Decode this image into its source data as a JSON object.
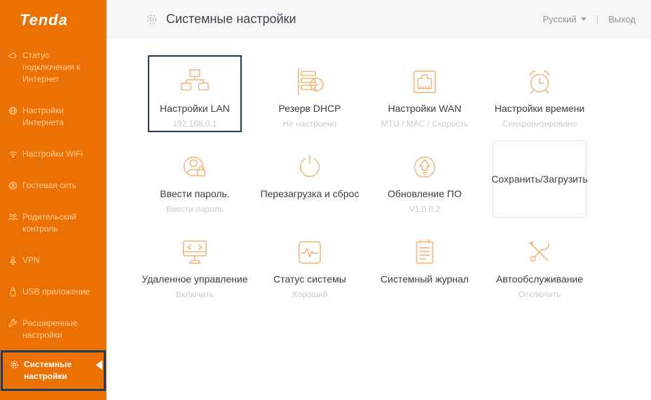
{
  "brand": {
    "name": "Tenda"
  },
  "header": {
    "title": "Системные настройки",
    "language": "Русский",
    "divider": "|",
    "logout": "Выход"
  },
  "sidebar": {
    "items": [
      {
        "label": "Статус подключения к Интернет",
        "icon": "connection-status"
      },
      {
        "label": "Настройки Интернета",
        "icon": "internet-settings"
      },
      {
        "label": "Настройки WiFi",
        "icon": "wifi"
      },
      {
        "label": "Гостевая сеть",
        "icon": "guest-network"
      },
      {
        "label": "Родительский контроль",
        "icon": "parental-control"
      },
      {
        "label": "VPN",
        "icon": "vpn"
      },
      {
        "label": "USB приложение",
        "icon": "usb"
      },
      {
        "label": "Расширенные настройки",
        "icon": "advanced-settings"
      },
      {
        "label": "Системные настройки",
        "icon": "system-settings",
        "active": true
      }
    ]
  },
  "tiles": [
    {
      "title": "Настройки LAN",
      "subtitle": "192.168.0.1",
      "icon": "lan-network",
      "selected": true
    },
    {
      "title": "Резерв DHCP",
      "subtitle": "Не настроено",
      "icon": "dhcp-list"
    },
    {
      "title": "Настройки WAN",
      "subtitle": "MTU / MAC / Скорость",
      "icon": "ethernet-port"
    },
    {
      "title": "Настройки времени",
      "subtitle": "Синхронизировано",
      "icon": "alarm-clock"
    },
    {
      "title": "Ввести пароль.",
      "subtitle": "Ввести пароль",
      "icon": "user-lock"
    },
    {
      "title": "Перезагрузка и сброс",
      "subtitle": "",
      "icon": "power"
    },
    {
      "title": "Обновление ПО",
      "subtitle": "V1.0.0.2",
      "icon": "upload-arrow"
    },
    {
      "title": "Сохранить/Загрузить",
      "subtitle": "",
      "icon": "",
      "card": true
    },
    {
      "title": "Удаленное управление",
      "subtitle": "Включить",
      "icon": "monitor-code"
    },
    {
      "title": "Статус системы",
      "subtitle": "Хороший",
      "icon": "pulse"
    },
    {
      "title": "Системный журнал",
      "subtitle": "",
      "icon": "notepad"
    },
    {
      "title": "Автообслуживание",
      "subtitle": "Отключить",
      "icon": "tools"
    }
  ],
  "colors": {
    "sidebar_orange": "#EC7104",
    "sidebar_text": "#FFCE96",
    "selection_navy": "#1C3A5E",
    "icon_orange": "#F2B577",
    "header_bg": "#F7F7F8",
    "title_text": "#40444E",
    "subtitle_gray": "#C9C9CF"
  }
}
